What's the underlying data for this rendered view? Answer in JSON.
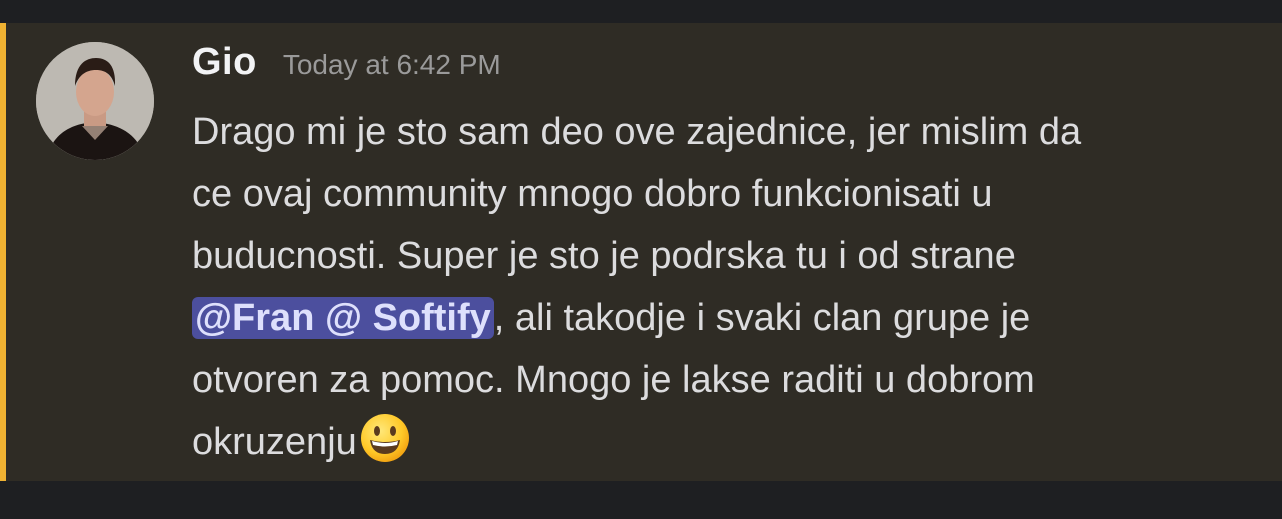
{
  "message": {
    "author": "Gio",
    "timestamp": "Today at 6:42 PM",
    "lines": [
      "Drago mi je sto sam deo ove zajednice, jer mislim da",
      "ce ovaj community mnogo dobro funkcionisati u",
      "budu cnosti. Super je sto je podrska tu i od strane"
    ],
    "mention": "@Fran @ Softify",
    "after_mention": ", ali takodje i svaki clan grupe je",
    "line5": "otvoren za pomoc. Mnogo je lakse raditi u dobrom",
    "line6": "okruzenju",
    "emoji": "grinning-face-emoji"
  },
  "colors": {
    "message_bg": "#2f2c25",
    "highlight_bar": "#f0b232",
    "mention_bg": "#4c4f9e",
    "page_bg": "#1e1f22"
  }
}
